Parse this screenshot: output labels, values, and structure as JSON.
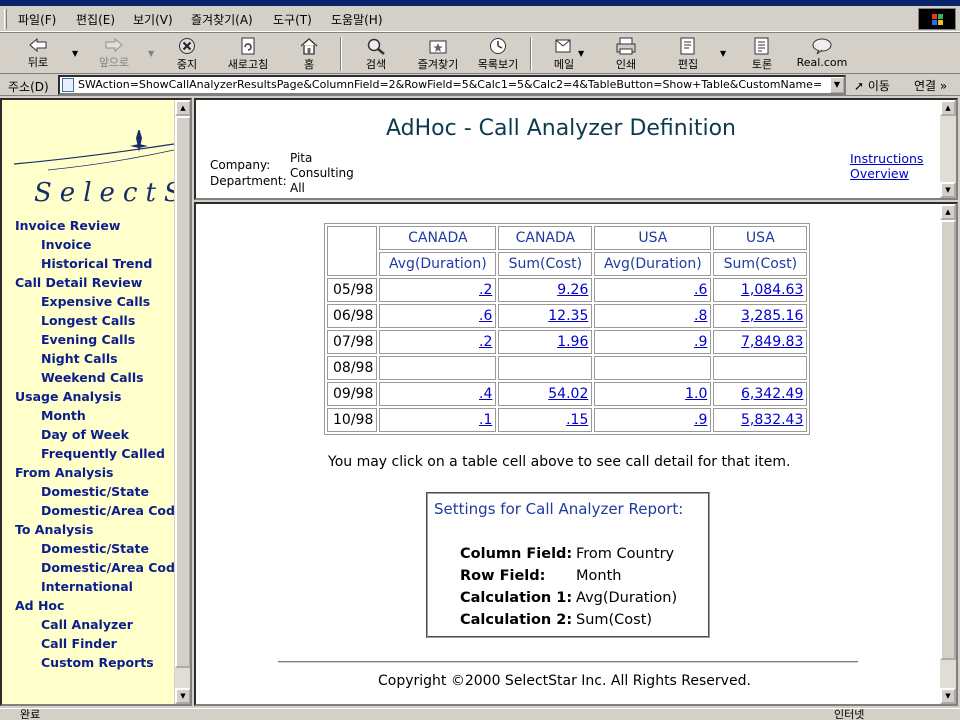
{
  "menu": {
    "items": [
      "파일(F)",
      "편집(E)",
      "보기(V)",
      "즐겨찾기(A)",
      "도구(T)",
      "도움말(H)"
    ]
  },
  "toolbar": {
    "back": "뒤로",
    "forward": "앞으로",
    "stop": "중지",
    "refresh": "새로고침",
    "home": "홈",
    "search": "검색",
    "favorites": "즐겨찾기",
    "history": "목록보기",
    "mail": "메일",
    "print": "인쇄",
    "edit": "편집",
    "discuss": "토론",
    "real": "Real.com"
  },
  "address": {
    "label": "주소(D)",
    "url": "SWAction=ShowCallAnalyzerResultsPage&ColumnField=2&RowField=5&Calc1=5&Calc2=4&TableButton=Show+Table&CustomName=",
    "go": "이동",
    "links": "연결 »"
  },
  "nav": {
    "logo_text": "SelectStar",
    "items": [
      {
        "label": "Invoice Review",
        "sub": false
      },
      {
        "label": "Invoice",
        "sub": true
      },
      {
        "label": "Historical Trend",
        "sub": true
      },
      {
        "label": "Call Detail Review",
        "sub": false
      },
      {
        "label": "Expensive Calls",
        "sub": true
      },
      {
        "label": "Longest Calls",
        "sub": true
      },
      {
        "label": "Evening Calls",
        "sub": true
      },
      {
        "label": "Night Calls",
        "sub": true
      },
      {
        "label": "Weekend Calls",
        "sub": true
      },
      {
        "label": "Usage Analysis",
        "sub": false
      },
      {
        "label": "Month",
        "sub": true
      },
      {
        "label": "Day of Week",
        "sub": true
      },
      {
        "label": "Frequently Called",
        "sub": true
      },
      {
        "label": "From Analysis",
        "sub": false
      },
      {
        "label": "Domestic/State",
        "sub": true
      },
      {
        "label": "Domestic/Area Code",
        "sub": true
      },
      {
        "label": "To Analysis",
        "sub": false
      },
      {
        "label": "Domestic/State",
        "sub": true
      },
      {
        "label": "Domestic/Area Code",
        "sub": true
      },
      {
        "label": "International",
        "sub": true
      },
      {
        "label": "Ad Hoc",
        "sub": false
      },
      {
        "label": "Call Analyzer",
        "sub": true
      },
      {
        "label": "Call Finder",
        "sub": true
      },
      {
        "label": "Custom Reports",
        "sub": true
      }
    ]
  },
  "header": {
    "title": "AdHoc - Call Analyzer Definition",
    "company_label": "Company:",
    "department_label": "Department:",
    "company_value_lines": [
      "Pita",
      "Consulting",
      "All"
    ],
    "instructions_link": "Instructions",
    "overview_link": "Overview"
  },
  "table": {
    "country_headers": [
      "CANADA",
      "CANADA",
      "USA",
      "USA"
    ],
    "calc_headers": [
      "Avg(Duration)",
      "Sum(Cost)",
      "Avg(Duration)",
      "Sum(Cost)"
    ],
    "rows": [
      {
        "month": "05/98",
        "values": [
          ".2",
          "9.26",
          ".6",
          "1,084.63"
        ]
      },
      {
        "month": "06/98",
        "values": [
          ".6",
          "12.35",
          ".8",
          "3,285.16"
        ]
      },
      {
        "month": "07/98",
        "values": [
          ".2",
          "1.96",
          ".9",
          "7,849.83"
        ]
      },
      {
        "month": "08/98",
        "values": [
          "",
          "",
          "",
          ""
        ]
      },
      {
        "month": "09/98",
        "values": [
          ".4",
          "54.02",
          "1.0",
          "6,342.49"
        ]
      },
      {
        "month": "10/98",
        "values": [
          ".1",
          ".15",
          ".9",
          "5,832.43"
        ]
      }
    ]
  },
  "hint": "You may click on a table cell above to see call detail for that item.",
  "settings": {
    "title": "Settings for Call Analyzer Report:",
    "fields": [
      {
        "label": "Column Field:",
        "value": "From Country"
      },
      {
        "label": "Row Field:",
        "value": "Month"
      },
      {
        "label": "Calculation 1:",
        "value": "Avg(Duration)"
      },
      {
        "label": "Calculation 2:",
        "value": "Sum(Cost)"
      }
    ]
  },
  "footer": {
    "copyright": "Copyright ©2000 SelectStar Inc. All Rights Reserved."
  },
  "status": {
    "text": "완료",
    "zone": "인터넷"
  },
  "colors": {
    "nav_bg": "#ffffcc",
    "nav_link": "#0c1e8c",
    "title": "#0d3a4f",
    "table_header": "#1f3ba0",
    "link": "#0000cc"
  }
}
